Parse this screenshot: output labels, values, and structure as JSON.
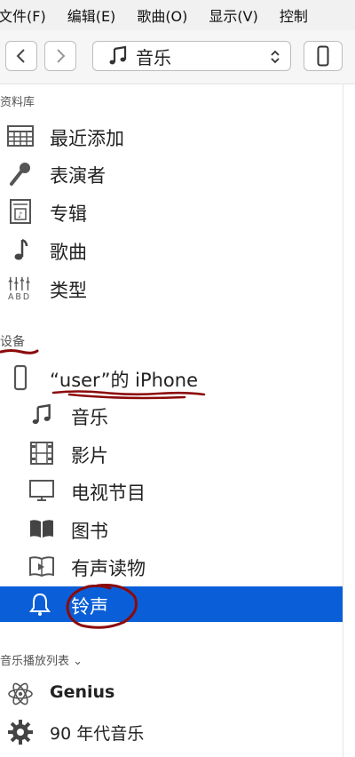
{
  "menubar": [
    "文件(F)",
    "编辑(E)",
    "歌曲(O)",
    "显示(V)",
    "控制"
  ],
  "toolbar": {
    "media_label": "音乐"
  },
  "library": {
    "header": "资料库",
    "items": [
      {
        "label": "最近添加",
        "icon": "calendar-grid-icon"
      },
      {
        "label": "表演者",
        "icon": "microphone-icon"
      },
      {
        "label": "专辑",
        "icon": "album-icon"
      },
      {
        "label": "歌曲",
        "icon": "music-note-icon"
      },
      {
        "label": "类型",
        "icon": "genre-icon"
      }
    ]
  },
  "devices": {
    "header": "设备",
    "device_name": "“user”的 iPhone",
    "items": [
      {
        "label": "音乐",
        "icon": "music-note-icon"
      },
      {
        "label": "影片",
        "icon": "film-icon"
      },
      {
        "label": "电视节目",
        "icon": "tv-icon"
      },
      {
        "label": "图书",
        "icon": "book-icon"
      },
      {
        "label": "有声读物",
        "icon": "audiobook-icon"
      },
      {
        "label": "铃声",
        "icon": "bell-icon",
        "selected": true
      }
    ]
  },
  "playlists": {
    "header": "音乐播放列表 ⌄",
    "items": [
      {
        "label": "Genius",
        "icon": "atom-icon"
      },
      {
        "label": "90 年代音乐",
        "icon": "gear-icon"
      }
    ]
  },
  "colors": {
    "selection": "#0a5fd8",
    "annotation": "#8b0a0a"
  }
}
